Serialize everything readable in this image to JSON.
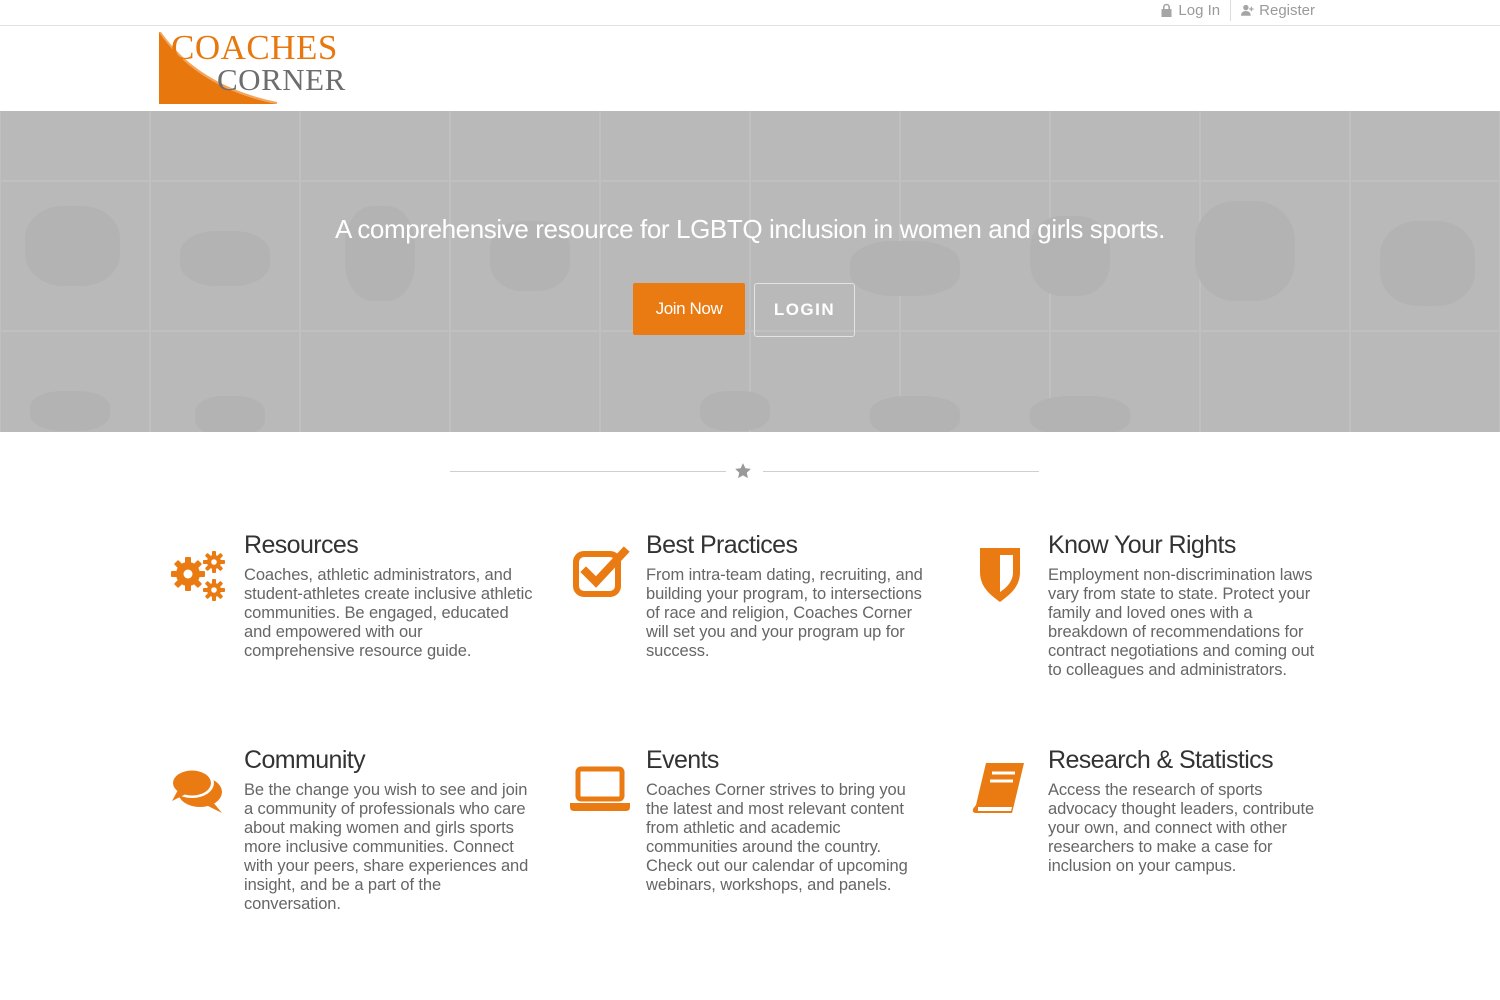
{
  "topbar": {
    "login_label": "Log In",
    "register_label": "Register"
  },
  "logo": {
    "line1": "COACHES",
    "line2": "CORNER"
  },
  "hero": {
    "tagline": "A  comprehensive resource for LGBTQ inclusion in women and girls sports.",
    "join_label": "Join Now",
    "login_label": "LOGIN"
  },
  "colors": {
    "accent": "#ea7a12",
    "hero_bg": "#b9b9b9"
  },
  "features": [
    {
      "icon": "gears-icon",
      "title": "Resources",
      "text": "Coaches, athletic administrators, and student-athletes create inclusive athletic communities.  Be engaged, educated and empowered with our comprehensive resource guide."
    },
    {
      "icon": "checkbox-icon",
      "title": "Best Practices",
      "text": "From intra-team dating, recruiting, and building your program, to intersections of race and religion, Coaches Corner will set you and your program up for success."
    },
    {
      "icon": "shield-icon",
      "title": "Know Your Rights",
      "text": "Employment non-discrimination laws vary from state to state. Protect your family and loved ones with a breakdown of recommendations for contract negotiations and coming out to colleagues and administrators."
    },
    {
      "icon": "chat-bubbles-icon",
      "title": "Community",
      "text": "Be the change you wish to see and join a community of professionals who care about making women and girls sports more inclusive communities. Connect with your peers, share experiences and insight, and be a part of the conversation."
    },
    {
      "icon": "laptop-icon",
      "title": "Events",
      "text": "Coaches Corner strives to bring you the latest and most relevant content from athletic and academic communities around the country. Check out our calendar of upcoming webinars, workshops, and panels."
    },
    {
      "icon": "book-icon",
      "title": "Research & Statistics",
      "text": "Access the research of sports advocacy thought leaders, contribute your own, and connect with other researchers to make a case for inclusion on your campus."
    }
  ]
}
